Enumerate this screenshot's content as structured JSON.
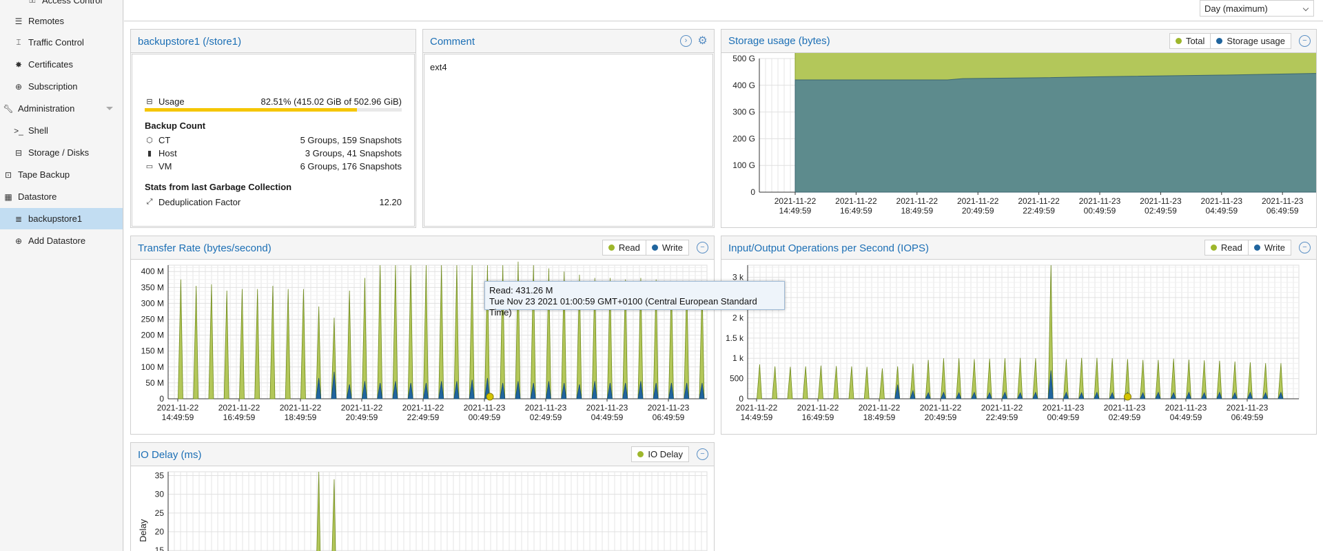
{
  "sidebar": {
    "items": [
      {
        "label": "Access Control",
        "icon": "key-icon"
      },
      {
        "label": "Remotes",
        "icon": "server-list-icon"
      },
      {
        "label": "Traffic Control",
        "icon": "traffic-icon"
      },
      {
        "label": "Certificates",
        "icon": "certificate-icon"
      },
      {
        "label": "Subscription",
        "icon": "support-icon"
      },
      {
        "label": "Administration",
        "icon": "wrench-icon"
      },
      {
        "label": "Shell",
        "icon": "terminal-icon"
      },
      {
        "label": "Storage / Disks",
        "icon": "disk-icon"
      },
      {
        "label": "Tape Backup",
        "icon": "tape-icon"
      },
      {
        "label": "Datastore",
        "icon": "archive-icon"
      },
      {
        "label": "backupstore1",
        "icon": "database-icon"
      },
      {
        "label": "Add Datastore",
        "icon": "plus-circle-icon"
      }
    ],
    "shell_prefix": ">_"
  },
  "toolbar": {
    "timeframe": "Day (maximum)"
  },
  "summary": {
    "title": "backupstore1 (/store1)",
    "usage_label": "Usage",
    "usage_value": "82.51% (415.02 GiB of 502.96 GiB)",
    "usage_fraction": 0.8251,
    "backup_count_title": "Backup Count",
    "ct_label": "CT",
    "ct_value": "5 Groups, 159 Snapshots",
    "host_label": "Host",
    "host_value": "3 Groups, 41 Snapshots",
    "vm_label": "VM",
    "vm_value": "6 Groups, 176 Snapshots",
    "gc_title": "Stats from last Garbage Collection",
    "dedup_label": "Deduplication Factor",
    "dedup_value": "12.20"
  },
  "comment": {
    "title": "Comment",
    "text": "ext4"
  },
  "tooltip": {
    "line1": "Read: 431.26 M",
    "line2": "Tue Nov 23 2021 01:00:59 GMT+0100 (Central European Standard Time)"
  },
  "colors": {
    "green": "#9eb72c",
    "blue": "#20659e",
    "green_fill": "#b3c75a",
    "teal_fill": "#5d8b8d",
    "accent": "#1c6fb5",
    "bar": "#f5c600"
  },
  "chart_data": [
    {
      "id": "storage",
      "type": "area",
      "title": "Storage usage (bytes)",
      "legend": [
        "Total",
        "Storage usage"
      ],
      "y_ticks": [
        "0",
        "100 G",
        "200 G",
        "300 G",
        "400 G",
        "500 G"
      ],
      "ylim": [
        0,
        500
      ],
      "x_ticks": [
        [
          "2021-11-22",
          "14:49:59"
        ],
        [
          "2021-11-22",
          "16:49:59"
        ],
        [
          "2021-11-22",
          "18:49:59"
        ],
        [
          "2021-11-22",
          "20:49:59"
        ],
        [
          "2021-11-22",
          "22:49:59"
        ],
        [
          "2021-11-23",
          "00:49:59"
        ],
        [
          "2021-11-23",
          "02:49:59"
        ],
        [
          "2021-11-23",
          "04:49:59"
        ],
        [
          "2021-11-23",
          "06:49:59"
        ]
      ],
      "x_hours": [
        0,
        2,
        4,
        6,
        8,
        10,
        12,
        14,
        16
      ],
      "series": [
        {
          "name": "Total",
          "x": [
            0,
            17.4
          ],
          "values": [
            540,
            540
          ]
        },
        {
          "name": "Storage usage",
          "x": [
            0,
            5,
            5.5,
            8,
            10,
            14,
            17.4
          ],
          "values": [
            420,
            420,
            425,
            428,
            432,
            438,
            445
          ]
        }
      ]
    },
    {
      "id": "transfer",
      "type": "area",
      "title": "Transfer Rate (bytes/second)",
      "legend": [
        "Read",
        "Write"
      ],
      "y_ticks": [
        "0",
        "50 M",
        "100 M",
        "150 M",
        "200 M",
        "250 M",
        "300 M",
        "350 M",
        "400 M"
      ],
      "ylim": [
        0,
        420
      ],
      "x_ticks": [
        [
          "2021-11-22",
          "14:49:59"
        ],
        [
          "2021-11-22",
          "16:49:59"
        ],
        [
          "2021-11-22",
          "18:49:59"
        ],
        [
          "2021-11-22",
          "20:49:59"
        ],
        [
          "2021-11-22",
          "22:49:59"
        ],
        [
          "2021-11-23",
          "00:49:59"
        ],
        [
          "2021-11-23",
          "02:49:59"
        ],
        [
          "2021-11-23",
          "04:49:59"
        ],
        [
          "2021-11-23",
          "06:49:59"
        ]
      ],
      "x_hours": [
        0,
        2,
        4,
        6,
        8,
        10,
        12,
        14,
        16
      ],
      "series": [
        {
          "name": "Read",
          "spike_hours": [
            0.1,
            0.6,
            1.1,
            1.6,
            2.1,
            2.6,
            3.1,
            3.6,
            4.1,
            4.6,
            5.1,
            5.6,
            6.1,
            6.6,
            7.1,
            7.6,
            8.1,
            8.6,
            9.1,
            9.6,
            10.1,
            10.6,
            11.1,
            11.6,
            12.1,
            12.6,
            13.1,
            13.6,
            14.1,
            14.6,
            15.1,
            15.6,
            16.1,
            16.6,
            17.1
          ],
          "values": [
            375,
            355,
            360,
            340,
            345,
            345,
            355,
            345,
            345,
            290,
            255,
            340,
            380,
            420,
            420,
            420,
            420,
            420,
            420,
            420,
            420,
            420,
            431,
            420,
            410,
            400,
            390,
            380,
            380,
            375,
            380,
            375,
            370,
            365,
            360
          ]
        },
        {
          "name": "Write",
          "spike_hours": [
            4.6,
            5.1,
            5.6,
            6.1,
            6.6,
            7.1,
            7.6,
            8.1,
            8.6,
            9.1,
            9.6,
            10.1,
            10.6,
            11.1,
            11.6,
            12.1,
            12.6,
            13.1,
            13.6,
            14.1,
            14.6,
            15.1,
            15.6,
            16.1,
            16.6,
            17.1
          ],
          "values": [
            65,
            85,
            45,
            55,
            50,
            55,
            50,
            50,
            55,
            55,
            60,
            65,
            50,
            55,
            50,
            55,
            50,
            45,
            55,
            50,
            50,
            55,
            50,
            50,
            50,
            50
          ]
        }
      ],
      "highlight": {
        "hour": 10.18,
        "value": 431.26
      }
    },
    {
      "id": "iops",
      "type": "area",
      "title": "Input/Output Operations per Second (IOPS)",
      "legend": [
        "Read",
        "Write"
      ],
      "y_ticks": [
        "0",
        "500",
        "1 k",
        "1.5 k",
        "2 k",
        "2.5 k",
        "3 k"
      ],
      "ylim": [
        0,
        3300
      ],
      "x_ticks": [
        [
          "2021-11-22",
          "14:49:59"
        ],
        [
          "2021-11-22",
          "16:49:59"
        ],
        [
          "2021-11-22",
          "18:49:59"
        ],
        [
          "2021-11-22",
          "20:49:59"
        ],
        [
          "2021-11-22",
          "22:49:59"
        ],
        [
          "2021-11-23",
          "00:49:59"
        ],
        [
          "2021-11-23",
          "02:49:59"
        ],
        [
          "2021-11-23",
          "04:49:59"
        ],
        [
          "2021-11-23",
          "06:49:59"
        ]
      ],
      "x_hours": [
        0,
        2,
        4,
        6,
        8,
        10,
        12,
        14,
        16
      ],
      "series": [
        {
          "name": "Read",
          "spike_hours": [
            0.1,
            0.6,
            1.1,
            1.6,
            2.1,
            2.6,
            3.1,
            3.6,
            4.1,
            4.6,
            5.1,
            5.6,
            6.1,
            6.6,
            7.1,
            7.6,
            8.1,
            8.6,
            9.1,
            9.6,
            10.1,
            10.6,
            11.1,
            11.6,
            12.1,
            12.6,
            13.1,
            13.6,
            14.1,
            14.6,
            15.1,
            15.6,
            16.1,
            16.6,
            17.1
          ],
          "values": [
            850,
            800,
            790,
            800,
            820,
            810,
            800,
            790,
            750,
            800,
            870,
            960,
            1000,
            1000,
            980,
            990,
            1000,
            1010,
            1000,
            3300,
            980,
            1010,
            1010,
            1000,
            980,
            960,
            960,
            990,
            970,
            950,
            940,
            920,
            900,
            880,
            880
          ]
        },
        {
          "name": "Write",
          "spike_hours": [
            4.6,
            5.1,
            5.6,
            6.1,
            6.6,
            7.1,
            7.6,
            8.1,
            8.6,
            9.1,
            9.6,
            10.1,
            10.6,
            11.1,
            11.6,
            12.1,
            12.6,
            13.1,
            13.6,
            14.1,
            14.6,
            15.1,
            15.6,
            16.1,
            16.6,
            17.1
          ],
          "values": [
            350,
            200,
            150,
            160,
            150,
            160,
            150,
            160,
            150,
            160,
            700,
            160,
            150,
            160,
            150,
            160,
            150,
            160,
            150,
            160,
            150,
            160,
            150,
            160,
            150,
            160
          ]
        }
      ]
    },
    {
      "id": "iodelay",
      "type": "area",
      "title": "IO Delay (ms)",
      "legend": [
        "IO Delay"
      ],
      "ylabel": "Delay",
      "y_ticks": [
        "15",
        "20",
        "25",
        "30",
        "35"
      ],
      "ylim": [
        10,
        36
      ],
      "series": [
        {
          "name": "IO Delay",
          "spike_hours": [
            4.6,
            5.1
          ],
          "values": [
            36,
            34
          ]
        }
      ]
    }
  ]
}
